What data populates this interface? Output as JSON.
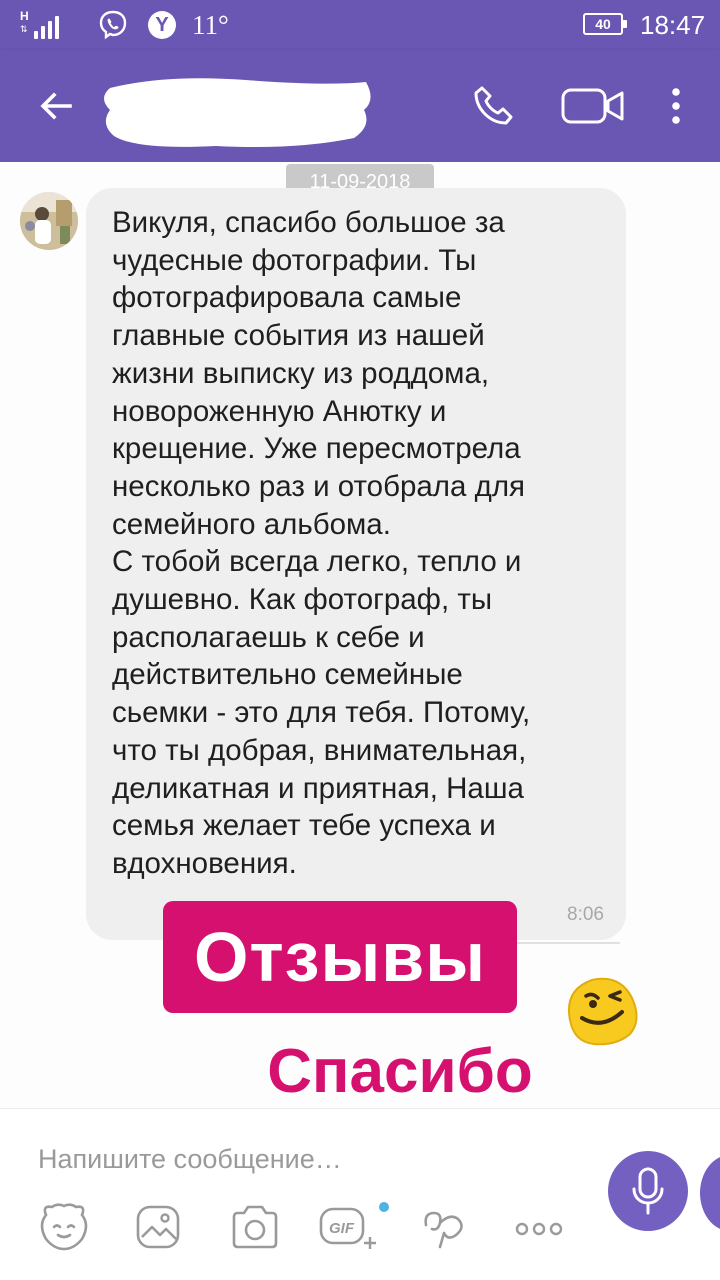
{
  "status_bar": {
    "network_letter": "H",
    "temperature": "11°",
    "battery_level": "40",
    "time": "18:47",
    "icons": [
      "signal-icon",
      "viber-icon",
      "weather-app-icon",
      "battery-icon"
    ]
  },
  "header": {
    "contact_name_redacted": true,
    "icons": [
      "back-arrow-icon",
      "phone-icon",
      "video-camera-icon",
      "more-vertical-icon"
    ]
  },
  "chat": {
    "date_chip": "11-09-2018",
    "message": {
      "text": "Викуля,  спасибо большое за\nчудесные фотографии. Ты\nфотографировала самые\nглавные события из нашей\nжизни выписку из роддома,\nновороженную Анютку  и\nкрещение.  Уже пересмотрела\nнесколько раз и отобрала для\nсемейного альбома.\nС тобой всегда легко,  тепло и\nдушевно. Как фотограф,  ты\nрасполагаешь к себе и\nдействительно семейные\nсьемки - это для тебя.  Потому,\nчто ты добрая, внимательная,\nделикатная и приятная,  Наша\nсемья желает тебе успеха и\nвдохновения.",
      "time": "8:06"
    },
    "overlay_reviews": "Отзывы",
    "overlay_thanks": "Спасибо"
  },
  "composer": {
    "placeholder": "Напишите сообщение…",
    "value": "",
    "toolbar": [
      "sticker-icon",
      "gallery-icon",
      "camera-icon",
      "gif-icon",
      "doodle-icon",
      "more-horizontal-icon",
      "microphone-icon"
    ]
  },
  "colors": {
    "brand_purple": "#6a56b3",
    "bubble_gray": "#efefef",
    "overlay_pink": "#d6106e",
    "gif_dot_blue": "#4fb3e2"
  }
}
